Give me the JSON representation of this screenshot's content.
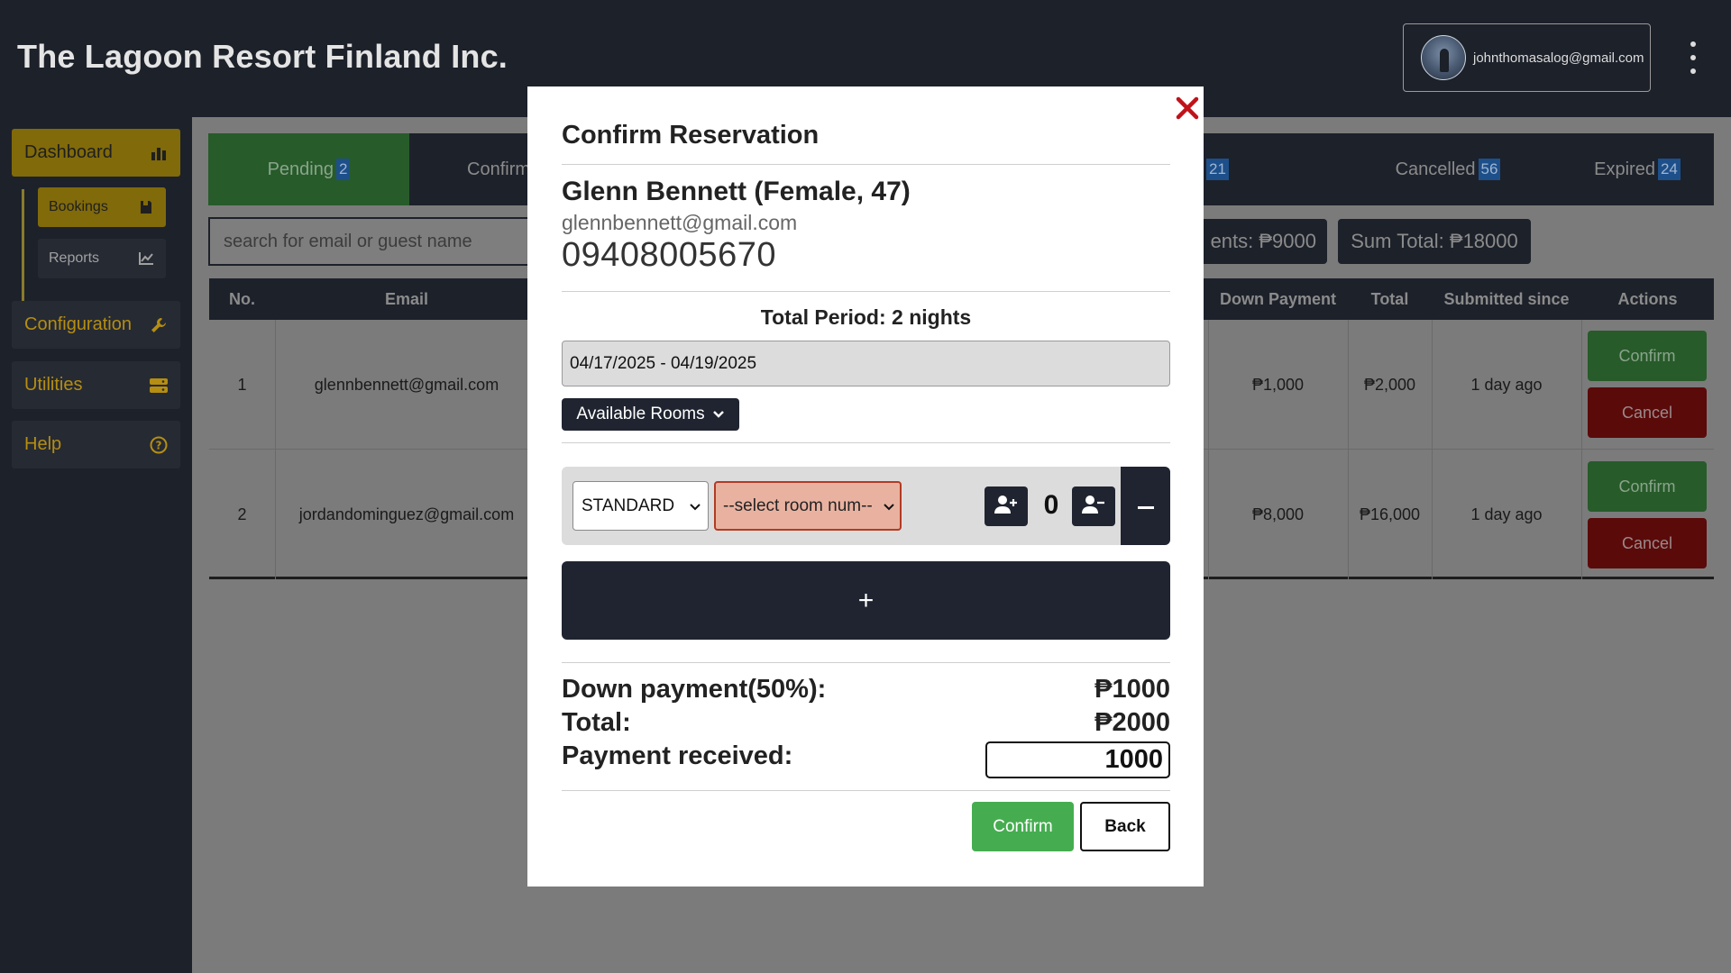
{
  "header": {
    "brand": "The Lagoon Resort Finland Inc.",
    "account_email": "johnthomasalog@gmail.com"
  },
  "sidebar": {
    "dashboard": "Dashboard",
    "bookings": "Bookings",
    "reports": "Reports",
    "configuration": "Configuration",
    "utilities": "Utilities",
    "help": "Help"
  },
  "tabs": [
    {
      "label": "Pending",
      "count": "2"
    },
    {
      "label": "Confirm",
      "count": ""
    },
    {
      "label": "",
      "count": "21"
    },
    {
      "label": "Cancelled",
      "count": "56"
    },
    {
      "label": "Expired",
      "count": "24"
    }
  ],
  "search": {
    "placeholder": "search for email or guest name"
  },
  "sums": {
    "down_payments": "ents: ₱9000",
    "sum_total": "Sum Total: ₱18000"
  },
  "table": {
    "headers": [
      "No.",
      "Email",
      "Down Payment",
      "Total",
      "Submitted since",
      "Actions"
    ],
    "rows": [
      {
        "no": "1",
        "email": "glennbennett@gmail.com",
        "down_payment": "₱1,000",
        "total": "₱2,000",
        "submitted": "1 day ago",
        "confirm": "Confirm",
        "cancel": "Cancel"
      },
      {
        "no": "2",
        "email": "jordandominguez@gmail.com",
        "down_payment": "₱8,000",
        "total": "₱16,000",
        "submitted": "1 day ago",
        "confirm": "Confirm",
        "cancel": "Cancel"
      }
    ]
  },
  "modal": {
    "title": "Confirm Reservation",
    "guest_name": "Glenn Bennett (Female, 47)",
    "guest_email": "glennbennett@gmail.com",
    "guest_phone": "09408005670",
    "total_period": "Total Period: 2 nights",
    "date_range": "04/17/2025 - 04/19/2025",
    "available_rooms": "Available Rooms",
    "room_type": "STANDARD",
    "room_number_placeholder": "--select room num--",
    "guest_count": "0",
    "add_room_symbol": "+",
    "down_payment_label": "Down payment(50%):",
    "down_payment_value": "₱1000",
    "total_label": "Total:",
    "total_value": "₱2000",
    "payment_received_label": "Payment received:",
    "payment_received_value": "1000",
    "confirm": "Confirm",
    "back": "Back"
  },
  "colors": {
    "confirm_green": "#45ad50",
    "close_red": "#c0121a",
    "dark_navy": "#1f2430",
    "room_select_error": "#e9b2a0"
  }
}
